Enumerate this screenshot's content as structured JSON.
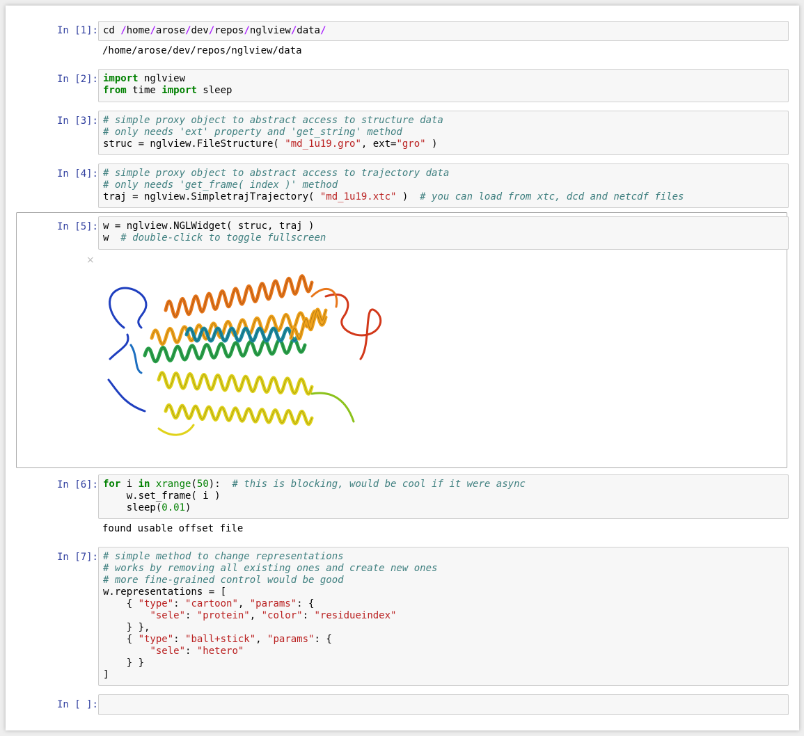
{
  "cells": [
    {
      "prompt": "In [1]:",
      "output": "/home/arose/dev/repos/nglview/data"
    },
    {
      "prompt": "In [2]:"
    },
    {
      "prompt": "In [3]:"
    },
    {
      "prompt": "In [4]:"
    },
    {
      "prompt": "In [5]:"
    },
    {
      "prompt": "In [6]:",
      "output": "found usable offset file"
    },
    {
      "prompt": "In [7]:"
    },
    {
      "prompt": "In [ ]:"
    }
  ],
  "code": {
    "c1": {
      "cmd": "cd ",
      "path": [
        "home",
        "arose",
        "dev",
        "repos",
        "nglview",
        "data"
      ],
      "sep": "/"
    },
    "c2": {
      "kw_import": "import",
      "mod": " nglview",
      "kw_from": "from",
      "mod2": " time ",
      "kw_import2": "import",
      "name": " sleep"
    },
    "c3": {
      "comment1": "# simple proxy object to abstract access to structure data",
      "comment2": "# only needs 'ext' property and 'get_string' method",
      "pre": "struc = nglview.FileStructure( ",
      "str1": "\"md_1u19.gro\"",
      "mid": ", ext=",
      "str2": "\"gro\"",
      "post": " )"
    },
    "c4": {
      "comment1": "# simple proxy object to abstract access to trajectory data",
      "comment2": "# only needs 'get_frame( index )' method",
      "pre": "traj = nglview.SimpletrajTrajectory( ",
      "str1": "\"md_1u19.xtc\"",
      "post": " )  ",
      "comment3": "# you can load from xtc, dcd and netcdf files"
    },
    "c5": {
      "line1": "w = nglview.NGLWidget( struc, traj )",
      "line2pre": "w  ",
      "comment": "# double-click to toggle fullscreen"
    },
    "c6": {
      "kw_for": "for",
      "var": " i ",
      "kw_in": "in",
      "sp": " ",
      "fn": "xrange",
      "open": "(",
      "num": "50",
      "close": "):  ",
      "comment": "# this is blocking, would be cool if it were async",
      "line2": "    w.set_frame( i )",
      "line3pre": "    sleep(",
      "num2": "0.01",
      "line3post": ")"
    },
    "c7": {
      "comment1": "# simple method to change representations",
      "comment2": "# works by removing all existing ones and create new ones",
      "comment3": "# more fine-grained control would be good",
      "l4": "w.representations = [",
      "l5a": "    { ",
      "s_type": "\"type\"",
      "colon": ": ",
      "s_cartoon": "\"cartoon\"",
      "comma": ", ",
      "s_params": "\"params\"",
      "l5b": ": {",
      "l6a": "        ",
      "s_sele": "\"sele\"",
      "s_protein": "\"protein\"",
      "s_color": "\"color\"",
      "s_residueindex": "\"residueindex\"",
      "l7": "    } },",
      "s_ballstick": "\"ball+stick\"",
      "s_hetero": "\"hetero\"",
      "l9close": "    } }",
      "l10": "]"
    }
  },
  "widget": {
    "close_label": "×"
  },
  "protein_colors": [
    "#1f3fbf",
    "#1d6fc0",
    "#1c8aa0",
    "#2aa24a",
    "#8cc21c",
    "#e0d21a",
    "#f0a21a",
    "#e8761a",
    "#d2381a"
  ]
}
